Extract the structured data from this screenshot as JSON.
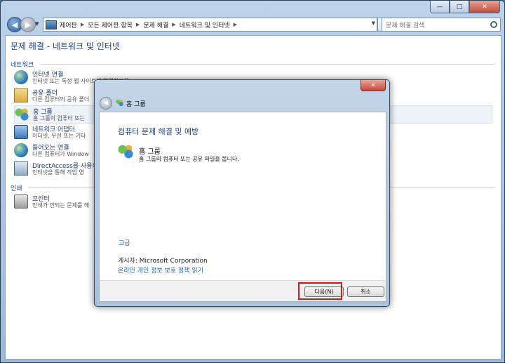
{
  "window": {
    "caption_buttons": {
      "minimize": "—",
      "maximize": "□",
      "close": "✕"
    }
  },
  "nav": {
    "back_glyph": "◀",
    "forward_glyph": "▶",
    "breadcrumbs": [
      "제어판",
      "모든 제어판 항목",
      "문제 해결",
      "네트워크 및 인터넷"
    ],
    "search_placeholder": "문제 해결 검색",
    "refresh_glyph": "↻"
  },
  "page": {
    "title": "문제 해결 - 네트워크 및 인터넷",
    "groups": [
      {
        "header": "네트워크",
        "items": [
          {
            "title": "인터넷 연결",
            "desc": "인터넷 또는 특정 웹 사이트에 연결하도록",
            "icon": "globe-icon"
          },
          {
            "title": "공유 폴더",
            "desc": "다른 컴퓨터의 공유 폴더",
            "icon": "folder-icon"
          },
          {
            "title": "홈 그룹",
            "desc": "홈 그룹의 컴퓨터 또는",
            "icon": "homegroup-icon"
          },
          {
            "title": "네트워크 어댑터",
            "desc": "이더넷, 무선 또는 기타",
            "icon": "network-adapter-icon"
          },
          {
            "title": "들어오는 연결",
            "desc": "다른 컴퓨터가 Window",
            "icon": "incoming-connection-icon"
          },
          {
            "title": "DirectAccess를 사용하여",
            "desc": "인터넷을 통해 작업 영",
            "icon": "directaccess-icon"
          }
        ]
      },
      {
        "header": "인쇄",
        "items": [
          {
            "title": "프린터",
            "desc": "인쇄가 안되는 문제를 해",
            "icon": "printer-icon"
          }
        ]
      }
    ]
  },
  "dialog": {
    "title": "홈 그룹",
    "close_glyph": "✕",
    "heading": "컴퓨터 문제 해결 및 예방",
    "option_title": "홈 그룹",
    "option_desc": "홈 그룹의 컴퓨터 또는 공유 파일을 봅니다.",
    "advanced_link": "고급",
    "publisher": "게시자:  Microsoft Corporation",
    "privacy_link": "온라인 개인 정보 보호 정책 읽기",
    "next_button": "다음(N)",
    "cancel_button": "취소"
  },
  "highlight_color": "#d9121d"
}
